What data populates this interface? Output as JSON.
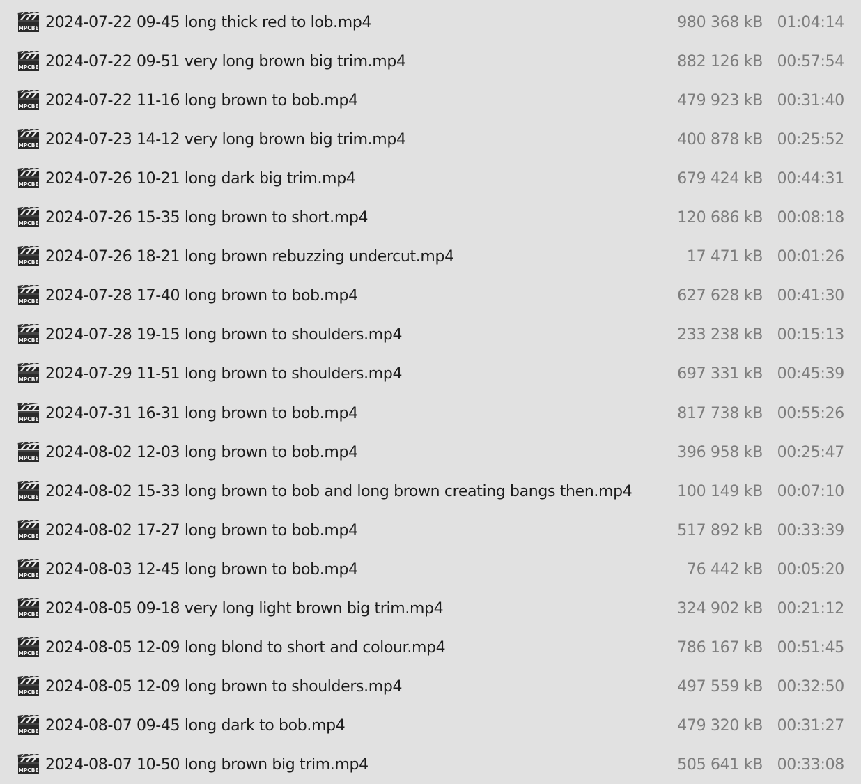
{
  "files": [
    {
      "name": "2024-07-22 09-45 long thick red to lob.mp4",
      "size": "980 368 kB",
      "duration": "01:04:14",
      "icon": "mpc-be-video-icon",
      "icon_label": "MPCBE"
    },
    {
      "name": "2024-07-22 09-51 very long brown big trim.mp4",
      "size": "882 126 kB",
      "duration": "00:57:54",
      "icon": "mpc-be-video-icon",
      "icon_label": "MPCBE"
    },
    {
      "name": "2024-07-22 11-16 long brown to bob.mp4",
      "size": "479 923 kB",
      "duration": "00:31:40",
      "icon": "mpc-be-video-icon",
      "icon_label": "MPCBE"
    },
    {
      "name": "2024-07-23 14-12 very long brown big trim.mp4",
      "size": "400 878 kB",
      "duration": "00:25:52",
      "icon": "mpc-be-video-icon",
      "icon_label": "MPCBE"
    },
    {
      "name": "2024-07-26 10-21 long dark big trim.mp4",
      "size": "679 424 kB",
      "duration": "00:44:31",
      "icon": "mpc-be-video-icon",
      "icon_label": "MPCBE"
    },
    {
      "name": "2024-07-26 15-35 long brown to short.mp4",
      "size": "120 686 kB",
      "duration": "00:08:18",
      "icon": "mpc-be-video-icon",
      "icon_label": "MPCBE"
    },
    {
      "name": "2024-07-26 18-21 long brown rebuzzing undercut.mp4",
      "size": "17 471 kB",
      "duration": "00:01:26",
      "icon": "mpc-be-video-icon",
      "icon_label": "MPCBE"
    },
    {
      "name": "2024-07-28 17-40 long brown to bob.mp4",
      "size": "627 628 kB",
      "duration": "00:41:30",
      "icon": "mpc-be-video-icon",
      "icon_label": "MPCBE"
    },
    {
      "name": "2024-07-28 19-15 long brown to shoulders.mp4",
      "size": "233 238 kB",
      "duration": "00:15:13",
      "icon": "mpc-be-video-icon",
      "icon_label": "MPCBE"
    },
    {
      "name": "2024-07-29 11-51 long brown to shoulders.mp4",
      "size": "697 331 kB",
      "duration": "00:45:39",
      "icon": "mpc-be-video-icon",
      "icon_label": "MPCBE"
    },
    {
      "name": "2024-07-31 16-31 long brown to bob.mp4",
      "size": "817 738 kB",
      "duration": "00:55:26",
      "icon": "mpc-be-video-icon",
      "icon_label": "MPCBE"
    },
    {
      "name": "2024-08-02 12-03 long brown to bob.mp4",
      "size": "396 958 kB",
      "duration": "00:25:47",
      "icon": "mpc-be-video-icon",
      "icon_label": "MPCBE"
    },
    {
      "name": "2024-08-02 15-33 long brown to bob and long brown creating bangs then.mp4",
      "size": "100 149 kB",
      "duration": "00:07:10",
      "icon": "mpc-be-video-icon",
      "icon_label": "MPCBE"
    },
    {
      "name": "2024-08-02 17-27 long brown to bob.mp4",
      "size": "517 892 kB",
      "duration": "00:33:39",
      "icon": "mpc-be-video-icon",
      "icon_label": "MPCBE"
    },
    {
      "name": "2024-08-03 12-45 long brown to bob.mp4",
      "size": "76 442 kB",
      "duration": "00:05:20",
      "icon": "mpc-be-video-icon",
      "icon_label": "MPCBE"
    },
    {
      "name": "2024-08-05 09-18 very long light brown big trim.mp4",
      "size": "324 902 kB",
      "duration": "00:21:12",
      "icon": "mpc-be-video-icon",
      "icon_label": "MPCBE"
    },
    {
      "name": "2024-08-05 12-09 long blond to short and colour.mp4",
      "size": "786 167 kB",
      "duration": "00:51:45",
      "icon": "mpc-be-video-icon",
      "icon_label": "MPCBE"
    },
    {
      "name": "2024-08-05 12-09 long brown to shoulders.mp4",
      "size": "497 559 kB",
      "duration": "00:32:50",
      "icon": "mpc-be-video-icon",
      "icon_label": "MPCBE"
    },
    {
      "name": "2024-08-07 09-45 long dark to bob.mp4",
      "size": "479 320 kB",
      "duration": "00:31:27",
      "icon": "mpc-be-video-icon",
      "icon_label": "MPCBE"
    },
    {
      "name": "2024-08-07 10-50 long brown big trim.mp4",
      "size": "505 641 kB",
      "duration": "00:33:08",
      "icon": "mpc-be-video-icon",
      "icon_label": "MPCBE"
    }
  ]
}
